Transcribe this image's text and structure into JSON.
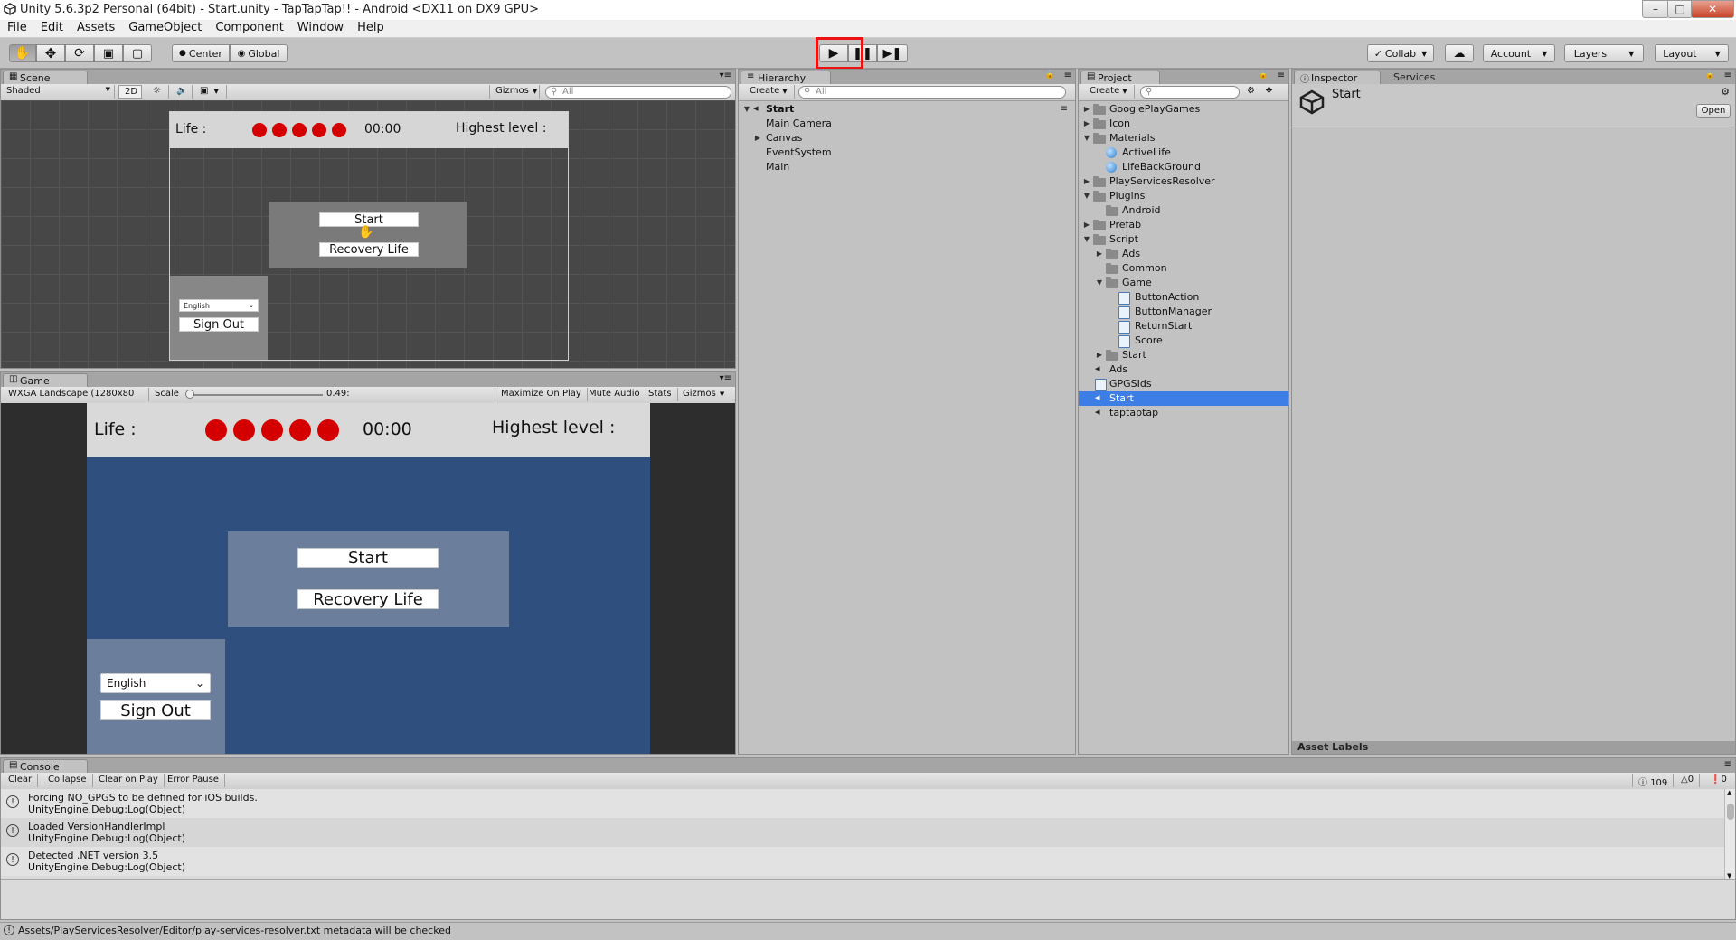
{
  "window": {
    "title": "Unity 5.6.3p2 Personal (64bit) - Start.unity - TapTapTap!! - Android <DX11 on DX9 GPU>",
    "controls": [
      "–",
      "□",
      "✕"
    ]
  },
  "menu": [
    "File",
    "Edit",
    "Assets",
    "GameObject",
    "Component",
    "Window",
    "Help"
  ],
  "toolbar": {
    "pivot_label": "Center",
    "space_label": "Global",
    "collab_label": "Collab",
    "account_label": "Account",
    "layers_label": "Layers",
    "layout_label": "Layout"
  },
  "scene": {
    "tab": "Scene",
    "shading": "Shaded",
    "mode_2d": "2D",
    "gizmos": "Gizmos",
    "search_placeholder": "All",
    "life_label": "Life :",
    "timer": "00:00",
    "highest_label": "Highest level :",
    "start_btn": "Start",
    "recovery_btn": "Recovery Life",
    "language": "English",
    "signout_btn": "Sign Out"
  },
  "game": {
    "tab": "Game",
    "resolution": "WXGA Landscape (1280x80",
    "scale_label": "Scale",
    "scale_value": "0.49:",
    "scale_fraction": 0.0,
    "maximize": "Maximize On Play",
    "mute": "Mute Audio",
    "stats": "Stats",
    "gizmos": "Gizmos",
    "life_label": "Life :",
    "timer": "00:00",
    "highest_label": "Highest level :",
    "start_btn": "Start",
    "recovery_btn": "Recovery Life",
    "language": "English",
    "signout_btn": "Sign Out",
    "life_count": 5
  },
  "hierarchy": {
    "tab": "Hierarchy",
    "create": "Create",
    "search_placeholder": "All",
    "scene_name": "Start",
    "items": [
      "Main Camera",
      "Canvas",
      "EventSystem",
      "Main"
    ]
  },
  "project": {
    "tab": "Project",
    "create": "Create",
    "items": [
      {
        "label": "GooglePlayGames",
        "type": "folder"
      },
      {
        "label": "Icon",
        "type": "folder"
      },
      {
        "label": "Materials",
        "type": "folder"
      },
      {
        "label": "ActiveLife",
        "type": "material"
      },
      {
        "label": "LifeBackGround",
        "type": "material"
      },
      {
        "label": "PlayServicesResolver",
        "type": "folder"
      },
      {
        "label": "Plugins",
        "type": "folder"
      },
      {
        "label": "Android",
        "type": "folder"
      },
      {
        "label": "Prefab",
        "type": "folder"
      },
      {
        "label": "Script",
        "type": "folder"
      },
      {
        "label": "Ads",
        "type": "folder"
      },
      {
        "label": "Common",
        "type": "folder"
      },
      {
        "label": "Game",
        "type": "folder"
      },
      {
        "label": "ButtonAction",
        "type": "script"
      },
      {
        "label": "ButtonManager",
        "type": "script"
      },
      {
        "label": "ReturnStart",
        "type": "script"
      },
      {
        "label": "Score",
        "type": "script"
      },
      {
        "label": "Start",
        "type": "folder"
      },
      {
        "label": "Ads",
        "type": "scene"
      },
      {
        "label": "GPGSIds",
        "type": "script"
      },
      {
        "label": "Start",
        "type": "scene",
        "selected": true
      },
      {
        "label": "taptaptap",
        "type": "scene"
      }
    ]
  },
  "inspector": {
    "tab": "Inspector",
    "services_tab": "Services",
    "object_name": "Start",
    "open_btn": "Open",
    "asset_labels": "Asset Labels"
  },
  "console": {
    "tab": "Console",
    "buttons": [
      "Clear",
      "Collapse",
      "Clear on Play",
      "Error Pause"
    ],
    "info_count": "109",
    "warn_count": "0",
    "error_count": "0",
    "messages": [
      {
        "line1": "Forcing NO_GPGS to be defined for iOS builds.",
        "line2": "UnityEngine.Debug:Log(Object)"
      },
      {
        "line1": "Loaded VersionHandlerImpl",
        "line2": "UnityEngine.Debug:Log(Object)"
      },
      {
        "line1": "Detected .NET version 3.5",
        "line2": "UnityEngine.Debug:Log(Object)"
      }
    ]
  },
  "statusbar": {
    "text": "Assets/PlayServicesResolver/Editor/play-services-resolver.txt metadata will be checked"
  },
  "colors": {
    "selection": "#3d7ee6",
    "game_background": "#2f4f7f",
    "life_dot": "#d40000",
    "highlight_box": "#ee1111"
  }
}
